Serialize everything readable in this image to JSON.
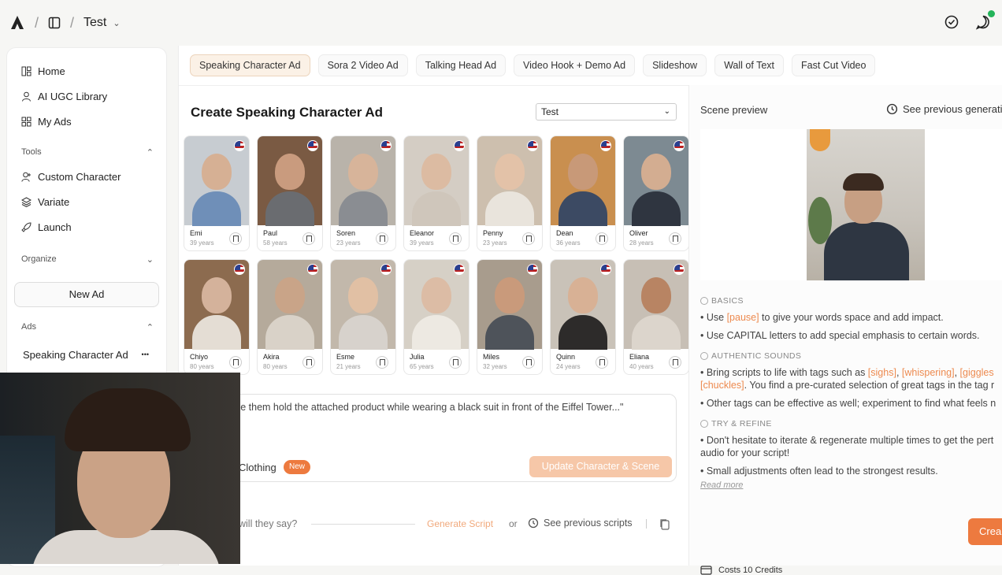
{
  "topbar": {
    "workspace": "Test"
  },
  "sidebar": {
    "nav": [
      {
        "label": "Home",
        "icon": "home-icon"
      },
      {
        "label": "AI UGC Library",
        "icon": "user-icon"
      },
      {
        "label": "My Ads",
        "icon": "grid-icon"
      }
    ],
    "tools_label": "Tools",
    "tools": [
      {
        "label": "Custom Character",
        "icon": "user-plus-icon"
      },
      {
        "label": "Variate",
        "icon": "layers-icon"
      },
      {
        "label": "Launch",
        "icon": "rocket-icon"
      }
    ],
    "organize_label": "Organize",
    "new_ad": "New Ad",
    "ads_label": "Ads",
    "ads_item": "Speaking Character Ad",
    "more": "•••"
  },
  "tabs": [
    "Speaking Character Ad",
    "Sora 2 Video Ad",
    "Talking Head Ad",
    "Video Hook + Demo Ad",
    "Slideshow",
    "Wall of Text",
    "Fast Cut Video"
  ],
  "create": {
    "title": "Create Speaking Character Ad",
    "select_value": "Test"
  },
  "characters": [
    {
      "name": "Emi",
      "age": "39 years",
      "skin": "#d6b094",
      "shirt": "#6f8fb8",
      "bg": "#c7ccd1"
    },
    {
      "name": "Paul",
      "age": "58 years",
      "skin": "#c99b7e",
      "shirt": "#6a6c70",
      "bg": "#7a5a43"
    },
    {
      "name": "Soren",
      "age": "23 years",
      "skin": "#d7b49a",
      "shirt": "#8a8d92",
      "bg": "#b9b3aa"
    },
    {
      "name": "Eleanor",
      "age": "39 years",
      "skin": "#dcbba2",
      "shirt": "#cfc6bb",
      "bg": "#d4cdc4"
    },
    {
      "name": "Penny",
      "age": "23 years",
      "skin": "#e3c2a8",
      "shirt": "#e9e4dc",
      "bg": "#cdbfae"
    },
    {
      "name": "Dean",
      "age": "36 years",
      "skin": "#c89978",
      "shirt": "#3c4a63",
      "bg": "#c98f4f"
    },
    {
      "name": "Oliver",
      "age": "28 years",
      "skin": "#d3ad91",
      "shirt": "#2f3540",
      "bg": "#7d8a92"
    },
    {
      "name": "Chiyo",
      "age": "80 years",
      "skin": "#d4b29b",
      "shirt": "#e4ddd4",
      "bg": "#8c6b4f"
    },
    {
      "name": "Akira",
      "age": "80 years",
      "skin": "#c9a488",
      "shirt": "#d9d2c8",
      "bg": "#b5aa9b"
    },
    {
      "name": "Esme",
      "age": "21 years",
      "skin": "#e1c0a4",
      "shirt": "#d7d2cc",
      "bg": "#c2b8ab"
    },
    {
      "name": "Julia",
      "age": "65 years",
      "skin": "#dcbca5",
      "shirt": "#ede9e2",
      "bg": "#d6d0c6"
    },
    {
      "name": "Miles",
      "age": "32 years",
      "skin": "#c99a7b",
      "shirt": "#4e535a",
      "bg": "#a89c8d"
    },
    {
      "name": "Quinn",
      "age": "24 years",
      "skin": "#d8b195",
      "shirt": "#2d2b2a",
      "bg": "#c9c2b8"
    },
    {
      "name": "Eliana",
      "age": "40 years",
      "skin": "#b88463",
      "shirt": "#dcd5cc",
      "bg": "#c7bfb5"
    }
  ],
  "prompt": {
    "text": "ke them hold the attached product while wearing a black suit in front of the Eiffel Tower...\"",
    "clothing": "Clothing",
    "new_badge": "New",
    "update_button": "Update Character & Scene",
    "say_prompt": "will they say?",
    "generate_script": "Generate Script",
    "or": "or",
    "previous_scripts": "See previous scripts"
  },
  "panel": {
    "title": "Scene preview",
    "see_previous": "See previous generati",
    "basics_h": "BASICS",
    "basics_1a": "• Use ",
    "basics_1tag": "[pause]",
    "basics_1b": " to give your words space and add impact.",
    "basics_2": "• Use CAPITAL letters to add special emphasis to certain words.",
    "sounds_h": "AUTHENTIC SOUNDS",
    "sounds_1a": "• Bring scripts to life with tags such as ",
    "sounds_tag1": "[sighs]",
    "sounds_comma1": ", ",
    "sounds_tag2": "[whispering]",
    "sounds_comma2": ", ",
    "sounds_tag3": "[giggles",
    "sounds_tag4": "[chuckles]",
    "sounds_1b": ". You find a pre-curated selection of great tags in the tag r",
    "sounds_2": "• Other tags can be effective as well; experiment to find what feels n",
    "refine_h": "TRY & REFINE",
    "refine_1": "• Don't hesitate to iterate & regenerate multiple times to get the pert",
    "refine_1b": "audio for your script!",
    "refine_2": "• Small adjustments often lead to the strongest results.",
    "read_more": "Read more",
    "costs": "Costs 10 Credits",
    "create_button": "Crea"
  },
  "colors": {
    "accent": "#ed7a3f",
    "accent_light": "#f6c7a8",
    "tag": "#ed8a4f"
  }
}
